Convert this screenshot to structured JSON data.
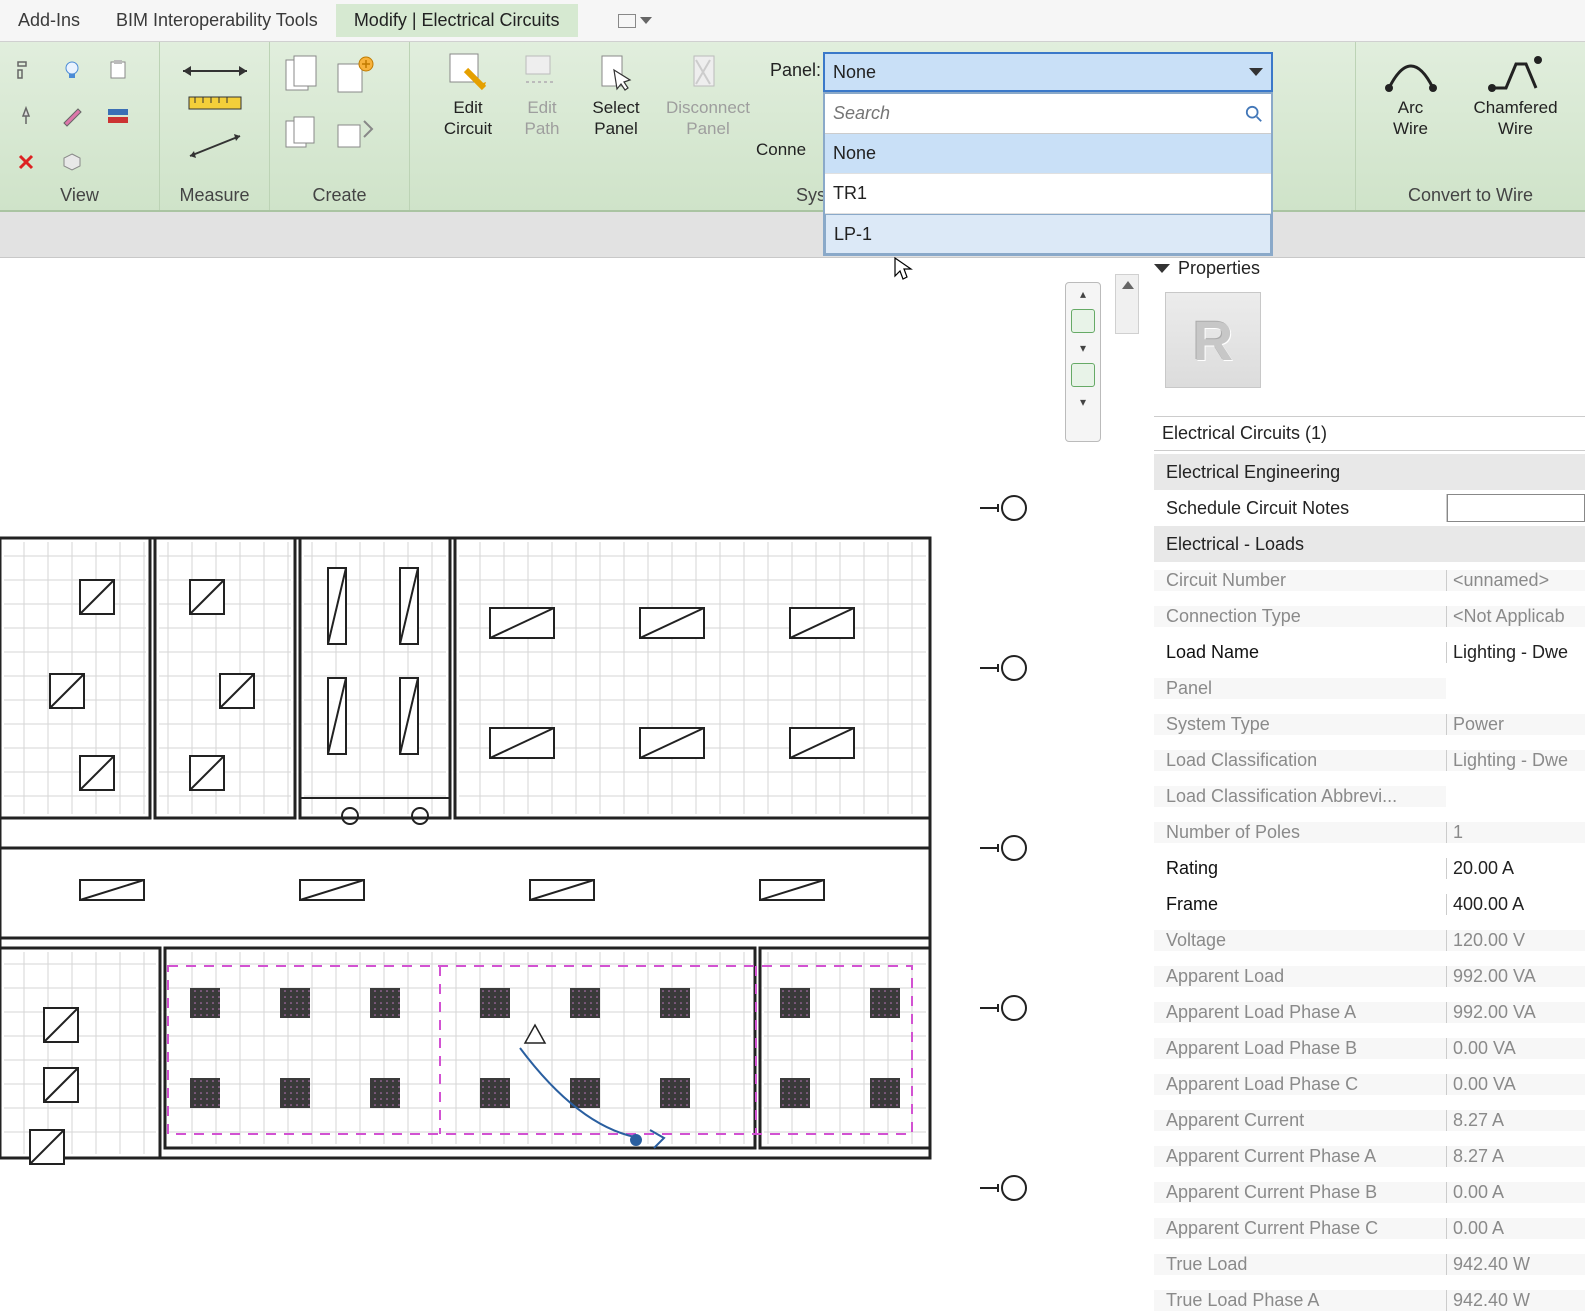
{
  "tabs": {
    "addins": "Add-Ins",
    "bim": "BIM Interoperability Tools",
    "modify": "Modify | Electrical Circuits"
  },
  "ribbon": {
    "groups": {
      "view": "View",
      "measure": "Measure",
      "create": "Create",
      "system_tools_partial": "Sys",
      "convert": "Convert to Wire"
    },
    "edit_circuit_top": "Edit",
    "edit_circuit_bot": "Circuit",
    "edit_path_top": "Edit",
    "edit_path_bot": "Path",
    "select_panel_top": "Select",
    "select_panel_bot": "Panel",
    "disconnect_panel_top": "Disconnect",
    "disconnect_panel_bot": "Panel",
    "connect_partial": "Conne",
    "arc_wire_top": "Arc",
    "arc_wire_bot": "Wire",
    "chamfered_top": "Chamfered",
    "chamfered_bot": "Wire",
    "panel_label": "Panel:"
  },
  "dropdown": {
    "selected": "None",
    "search_placeholder": "Search",
    "items": [
      "None",
      "TR1",
      "LP-1"
    ]
  },
  "properties": {
    "title": "Properties",
    "type_selector": "Electrical Circuits (1)",
    "sections": {
      "eng": "Electrical Engineering",
      "loads": "Electrical - Loads"
    },
    "rows": [
      {
        "k": "Schedule Circuit Notes",
        "v": "",
        "kind": "input"
      },
      {
        "k": "Circuit Number",
        "v": "<unnamed>",
        "kind": "readonly"
      },
      {
        "k": "Connection Type",
        "v": "<Not Applicab",
        "kind": "readonly"
      },
      {
        "k": "Load Name",
        "v": "Lighting - Dwe",
        "kind": "editable"
      },
      {
        "k": "Panel",
        "v": "",
        "kind": "readonly"
      },
      {
        "k": "System Type",
        "v": "Power",
        "kind": "readonly"
      },
      {
        "k": "Load Classification",
        "v": "Lighting - Dwe",
        "kind": "readonly"
      },
      {
        "k": "Load Classification Abbrevi...",
        "v": "",
        "kind": "readonly"
      },
      {
        "k": "Number of Poles",
        "v": "1",
        "kind": "readonly"
      },
      {
        "k": "Rating",
        "v": "20.00 A",
        "kind": "editable"
      },
      {
        "k": "Frame",
        "v": "400.00 A",
        "kind": "editable"
      },
      {
        "k": "Voltage",
        "v": "120.00 V",
        "kind": "readonly"
      },
      {
        "k": "Apparent Load",
        "v": "992.00 VA",
        "kind": "readonly"
      },
      {
        "k": "Apparent Load Phase A",
        "v": "992.00 VA",
        "kind": "readonly"
      },
      {
        "k": "Apparent Load Phase B",
        "v": "0.00 VA",
        "kind": "readonly"
      },
      {
        "k": "Apparent Load Phase C",
        "v": "0.00 VA",
        "kind": "readonly"
      },
      {
        "k": "Apparent Current",
        "v": "8.27 A",
        "kind": "readonly"
      },
      {
        "k": "Apparent Current Phase A",
        "v": "8.27 A",
        "kind": "readonly"
      },
      {
        "k": "Apparent Current Phase B",
        "v": "0.00 A",
        "kind": "readonly"
      },
      {
        "k": "Apparent Current Phase C",
        "v": "0.00 A",
        "kind": "readonly"
      },
      {
        "k": "True Load",
        "v": "942.40 W",
        "kind": "readonly"
      },
      {
        "k": "True Load Phase A",
        "v": "942.40 W",
        "kind": "readonly"
      }
    ]
  }
}
